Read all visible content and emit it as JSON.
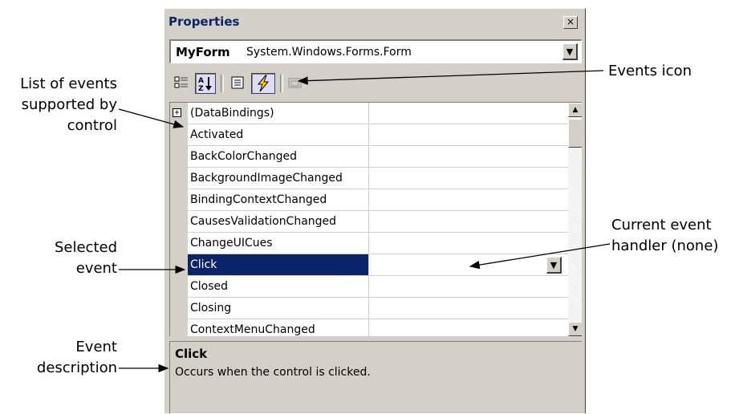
{
  "window": {
    "title": "Properties",
    "close_glyph": "×"
  },
  "object_selector": {
    "name": "MyForm",
    "type": "System.Windows.Forms.Form"
  },
  "toolbar": {
    "buttons": [
      {
        "icon": "categorized-icon"
      },
      {
        "icon": "alphabetical-icon",
        "label": "A Z"
      },
      {
        "icon": "properties-icon"
      },
      {
        "icon": "events-icon",
        "pressed": true
      },
      {
        "icon": "property-pages-icon"
      }
    ]
  },
  "events": [
    {
      "name": "(DataBindings)",
      "expandable": true,
      "expand_glyph": "+"
    },
    {
      "name": "Activated"
    },
    {
      "name": "BackColorChanged"
    },
    {
      "name": "BackgroundImageChanged"
    },
    {
      "name": "BindingContextChanged"
    },
    {
      "name": "CausesValidationChanged"
    },
    {
      "name": "ChangeUICues"
    },
    {
      "name": "Click",
      "selected": true
    },
    {
      "name": "Closed"
    },
    {
      "name": "Closing"
    },
    {
      "name": "ContextMenuChanged"
    }
  ],
  "description": {
    "title": "Click",
    "text": "Occurs when the control is clicked."
  },
  "callouts": {
    "list_of_events": [
      "List of events",
      "supported by",
      "control"
    ],
    "selected_event": [
      "Selected",
      "event"
    ],
    "event_description": [
      "Event",
      "description"
    ],
    "events_icon": [
      "Events icon"
    ],
    "current_handler": [
      "Current event",
      "handler (none)"
    ]
  },
  "colors": {
    "selection": "#0a246a",
    "face": "#d4d0c8"
  }
}
